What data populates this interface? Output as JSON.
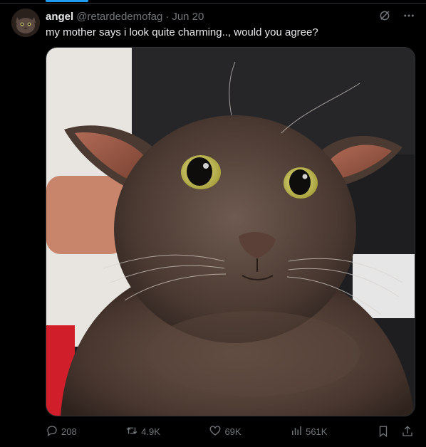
{
  "tweet": {
    "display_name": "angel",
    "handle": "@retardedemofag",
    "separator": "·",
    "date": "Jun 20",
    "text": "my mother says i look quite charming.., would you agree?"
  },
  "media": {
    "subject": "cat-photo"
  },
  "actions": {
    "replies": "208",
    "reposts": "4.9K",
    "likes": "69K",
    "views": "561K"
  },
  "icons": {
    "grok": "grok-icon",
    "more": "more-icon",
    "reply": "reply-icon",
    "repost": "repost-icon",
    "like": "like-icon",
    "views": "views-icon",
    "bookmark": "bookmark-icon",
    "share": "share-icon"
  },
  "colors": {
    "background": "#000000",
    "text": "#e7e9ea",
    "muted": "#71767b",
    "accent": "#1d9bf0",
    "border": "#2f3336"
  }
}
